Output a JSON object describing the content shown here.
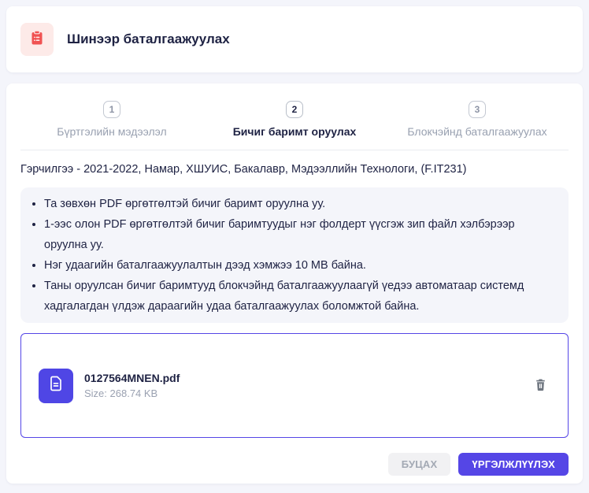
{
  "header": {
    "title": "Шинээр баталгаажуулах",
    "icon": "clipboard-list-icon"
  },
  "stepper": {
    "steps": [
      {
        "number": "1",
        "label": "Бүртгэлийн мэдээлэл",
        "active": false
      },
      {
        "number": "2",
        "label": "Бичиг баримт оруулах",
        "active": true
      },
      {
        "number": "3",
        "label": "Блокчэйнд баталгаажуулах",
        "active": false
      }
    ]
  },
  "certificate_line": "Гэрчилгээ - 2021-2022, Намар, ХШУИС, Бакалавр, Мэдээллийн Технологи, (F.IT231)",
  "instructions": [
    "Та зөвхөн PDF өргөтгөлтэй бичиг баримт оруулна уу.",
    "1-ээс олон PDF өргөтгөлтэй бичиг баримтуудыг нэг фолдерт үүсгэж зип файл хэлбэрээр оруулна уу.",
    "Нэг удаагийн баталгаажуулалтын дээд хэмжээ 10 MB байна.",
    "Таны оруулсан бичиг баримтууд блокчэйнд баталгаажуулаагүй үедээ автоматаар системд хадгалагдан үлдэж дараагийн удаа баталгаажуулах боломжтой байна."
  ],
  "file": {
    "name": "0127564MNEN.pdf",
    "size_label": "Size: 268.74 KB",
    "icon": "document-icon",
    "delete_icon": "trash-icon"
  },
  "buttons": {
    "back": "БУЦАХ",
    "continue": "ҮРГЭЛЖЛҮҮЛЭХ"
  },
  "colors": {
    "accent_purple": "#5546e6",
    "file_icon_purple": "#4f46e5",
    "danger_red": "#f05252",
    "icon_badge_bg": "#fdeae8",
    "info_box_bg": "#f4f5fa",
    "page_bg": "#f4f5fb",
    "dark_text": "#1e2243",
    "muted_text": "#98a0b0"
  }
}
